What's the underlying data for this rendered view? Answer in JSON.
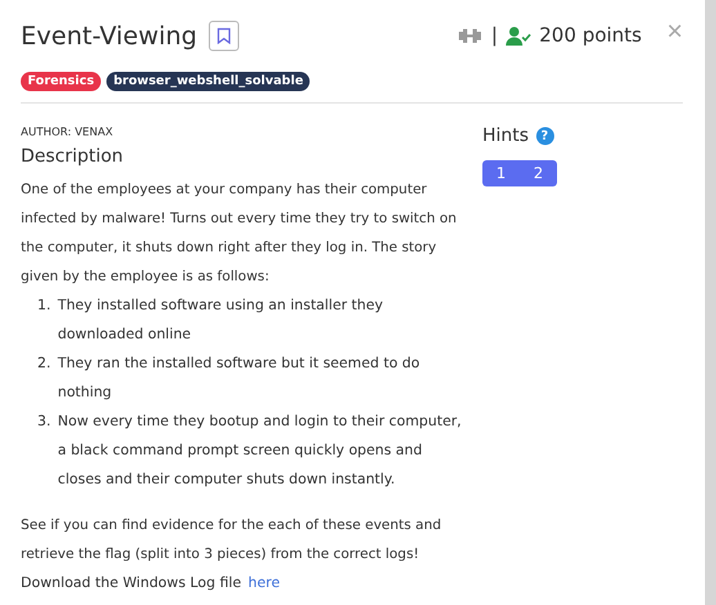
{
  "modal": {
    "title": "Event-Viewing",
    "bookmarked": false,
    "separator": "|",
    "points": "200 points",
    "close": "×",
    "tags": [
      {
        "label": "Forensics",
        "color": "#e8344a"
      },
      {
        "label": "browser_webshell_solvable",
        "color": "#263554"
      }
    ],
    "author": "AUTHOR: VENAX",
    "description_heading": "Description",
    "intro": "One of the employees at your company has their computer infected by malware! Turns out every time they try to switch on the computer, it shuts down right after they log in. The story given by the employee is as follows:",
    "steps": [
      {
        "number": "1.",
        "text": "They installed software using an installer they downloaded online"
      },
      {
        "number": "2.",
        "text": "They ran the installed software but it seemed to do nothing"
      },
      {
        "number": "3.",
        "text": "Now every time they bootup and login to their computer, a black command prompt screen quickly opens and closes and their computer shuts down instantly."
      }
    ],
    "outro": "See if you can find evidence for the each of these events and retrieve the flag (split into 3 pieces) from the correct logs!",
    "download_text": "Download the Windows Log file",
    "download_link": "here",
    "hints_heading": "Hints",
    "hint_help": "?",
    "hints": [
      {
        "label": "1"
      },
      {
        "label": "2"
      }
    ]
  }
}
